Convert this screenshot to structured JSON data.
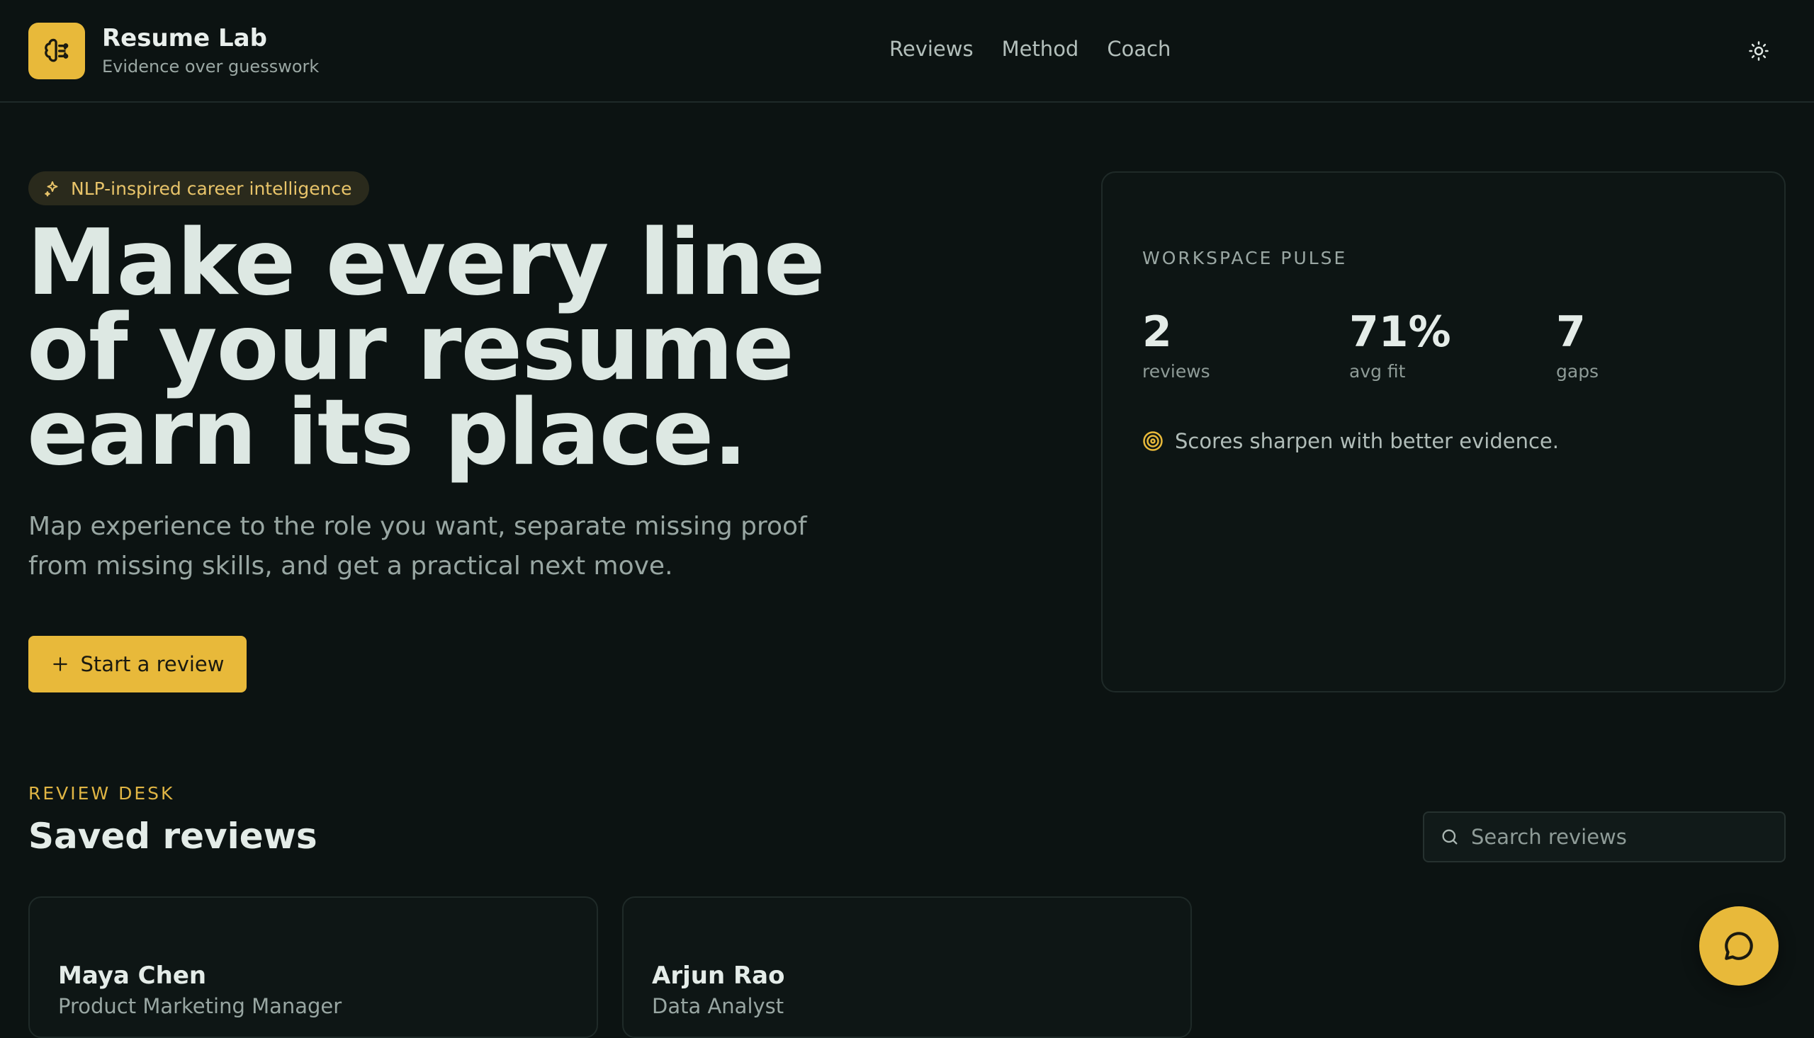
{
  "header": {
    "logo_icon": "brain-icon",
    "brand_title": "Resume Lab",
    "brand_subtitle": "Evidence over guesswork",
    "nav": [
      {
        "label": "Reviews"
      },
      {
        "label": "Method"
      },
      {
        "label": "Coach"
      }
    ],
    "theme_toggle_icon": "sun-icon"
  },
  "hero": {
    "pill_icon": "sparkles-icon",
    "pill_text": "NLP-inspired career intelligence",
    "title_lines": [
      "Make every line",
      "of your resume",
      "earn its place."
    ],
    "description_lines": [
      "Map experience to the role you want, separate missing proof",
      "from missing skills, and get a practical next move."
    ],
    "cta_label": "Start a review",
    "cta_icon": "plus-icon"
  },
  "pulse": {
    "label": "WORKSPACE PULSE",
    "stats": [
      {
        "value": "2",
        "label": "reviews"
      },
      {
        "value": "71%",
        "label": "avg fit"
      },
      {
        "value": "7",
        "label": "gaps"
      }
    ],
    "note_icon": "target-icon",
    "note": "Scores sharpen with better evidence."
  },
  "desk": {
    "eyebrow": "REVIEW DESK",
    "title": "Saved reviews",
    "search_placeholder": "Search reviews",
    "search_value": "",
    "cards": [
      {
        "name": "Maya Chen",
        "role": "Product Marketing Manager"
      },
      {
        "name": "Arjun Rao",
        "role": "Data Analyst"
      }
    ]
  },
  "chat": {
    "icon": "chat-bubble-icon"
  },
  "colors": {
    "background": "#0c1312",
    "accent": "#e8b93a",
    "text": "#e4ece8",
    "muted": "#98a6a2"
  }
}
